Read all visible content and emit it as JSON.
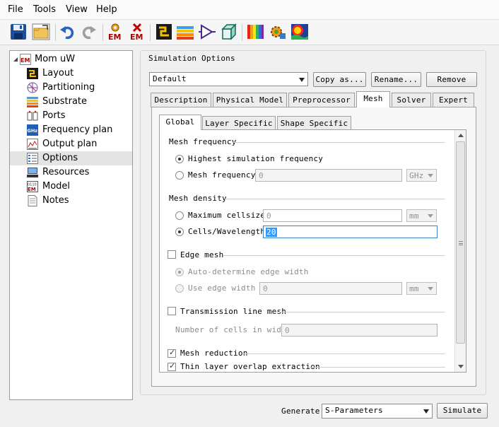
{
  "menu": [
    "File",
    "Tools",
    "View",
    "Help"
  ],
  "toolbar": {
    "icons": [
      "save-icon",
      "open-folder-icon",
      "undo-icon",
      "redo-icon",
      "em-gear-icon",
      "em-cancel-icon",
      "layout-icon",
      "substrate-icon",
      "amplifier-icon",
      "cube-3d-icon",
      "spectrum-icon",
      "settings-gear-icon",
      "field-plot-icon"
    ],
    "em_label": "EM"
  },
  "tree": {
    "root": "Mom uW",
    "items": [
      {
        "label": "Layout",
        "icon": "layout-icon"
      },
      {
        "label": "Partitioning",
        "icon": "partitioning-icon"
      },
      {
        "label": "Substrate",
        "icon": "substrate-icon"
      },
      {
        "label": "Ports",
        "icon": "ports-icon"
      },
      {
        "label": "Frequency plan",
        "icon": "frequency-plan-icon"
      },
      {
        "label": "Output plan",
        "icon": "output-plan-icon"
      },
      {
        "label": "Options",
        "icon": "options-icon"
      },
      {
        "label": "Resources",
        "icon": "resources-icon"
      },
      {
        "label": "Model",
        "icon": "model-icon"
      },
      {
        "label": "Notes",
        "icon": "notes-icon"
      }
    ],
    "ghz_badge": "GHz",
    "model_badge": "0110"
  },
  "sim": {
    "title": "Simulation Options",
    "preset": "Default",
    "copy_as": "Copy as...",
    "rename": "Rename...",
    "remove": "Remove"
  },
  "tabs": [
    "Description",
    "Physical Model",
    "Preprocessor",
    "Mesh",
    "Solver",
    "Expert"
  ],
  "subtabs": [
    "Global",
    "Layer Specific",
    "Shape Specific"
  ],
  "mesh": {
    "freq_header": "Mesh frequency",
    "highest": "Highest simulation frequency",
    "mesh_freq_label": "Mesh frequency",
    "mesh_freq_value": "0",
    "mesh_freq_unit": "GHz",
    "density_header": "Mesh density",
    "max_cell_label": "Maximum cellsize",
    "max_cell_value": "0",
    "max_cell_unit": "mm",
    "cells_wl_label": "Cells/Wavelength",
    "cells_wl_value": "20",
    "edge_header": "Edge mesh",
    "auto_edge": "Auto-determine edge width",
    "use_edge": "Use edge width",
    "edge_value": "0",
    "edge_unit": "mm",
    "tline_header": "Transmission line mesh",
    "ncells_label": "Number of cells in width",
    "ncells_value": "0",
    "reduction": "Mesh reduction",
    "thin_layer": "Thin layer overlap extraction"
  },
  "bottom": {
    "generate_label": "Generate:",
    "generate_value": "S-Parameters",
    "simulate": "Simulate"
  }
}
